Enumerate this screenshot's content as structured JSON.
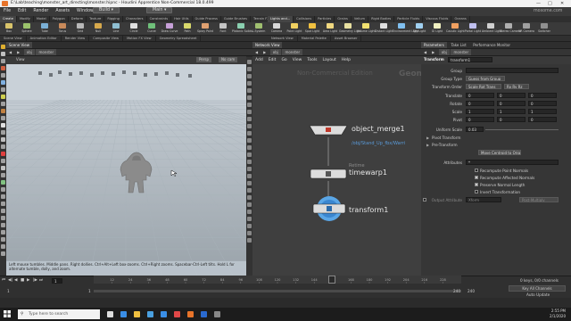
{
  "window": {
    "path": "E:\\Lab\\teaching\\monster_art_directing\\monster.hipnc",
    "title_suffix": "Houdini Apprentice Non-Commercial 18.0.499",
    "watermark_site": "mosome.com"
  },
  "menubar": {
    "items": [
      "File",
      "Edit",
      "Render",
      "Assets",
      "Windows",
      "Help"
    ],
    "build_dropdown": "Build",
    "main_dropdown": "Main"
  },
  "shelf_left": {
    "tabs": [
      "Create",
      "Modify",
      "Model",
      "Polygon",
      "Deform",
      "Texture",
      "Rigging",
      "Characters",
      "Constraints",
      "Hair Utils",
      "Guide Process",
      "Guide Brushes",
      "Terrain FX"
    ],
    "tools": [
      "Box",
      "Sphere",
      "Tube",
      "Torus",
      "Grid",
      "Null",
      "Line",
      "Circle",
      "Curve",
      "Draw Curve",
      "Path",
      "Spray Paint",
      "Font",
      "Platonic Solids",
      "L-System"
    ]
  },
  "shelf_right": {
    "tabs": [
      "Lights and...",
      "Collisions",
      "Particles",
      "Grains",
      "Vellum",
      "Rigid Bodies",
      "Particle Fluids",
      "Viscous Fluids",
      "Oceans"
    ],
    "tools": [
      "Camera",
      "Point Light",
      "Spot Light",
      "Area Light",
      "Geometry Light",
      "Volume Light",
      "Distant Light",
      "Environment Light",
      "Sky Light",
      "GI Light",
      "Caustic Light",
      "Portal Light",
      "Ambient Light",
      "Stereo Camera",
      "VR Camera",
      "Switcher"
    ]
  },
  "pane_tabs": [
    "Scene View",
    "Animation Editor",
    "Render View",
    "Composite View",
    "Motion FX View",
    "Geometry Spreadsheet",
    "Network View",
    "Material Palette",
    "Asset Browser",
    "Parameters",
    "Take List",
    "Performance Monitor"
  ],
  "viewport": {
    "path_obj": "obj",
    "path_node": "monster",
    "view_label": "View",
    "persp_label": "Persp",
    "cam_label": "No cam",
    "status_text": "Left mouse tumbles. Middle pans. Right dollies. Ctrl+Alt+Left box-zooms. Ctrl+Right zooms. Spacebar-Ctrl-Left tilts. Hold L for alternate tumble, dolly, and zoom."
  },
  "network": {
    "path_obj": "obj",
    "path_node": "monster",
    "menu": [
      "Add",
      "Edit",
      "Go",
      "View",
      "Tools",
      "Layout",
      "Help"
    ],
    "watermark": "Non-Commercial Edition",
    "context_label": "Geometry",
    "nodes": [
      {
        "name": "object_merge1",
        "sub": "/obj/Stand_Up_fbx/Warri"
      },
      {
        "name": "timewarp1",
        "sub": "Retime"
      },
      {
        "name": "transform1",
        "sub": ""
      }
    ]
  },
  "parameters": {
    "node_type": "Transform",
    "node_name": "transform1",
    "path_obj": "obj",
    "path_node": "monster",
    "rows": {
      "group": "Group",
      "group_type": "Group Type",
      "group_type_value": "Guess from Group",
      "transform_order": "Transform Order",
      "transform_order_value": "Scale Rot Trans",
      "rot_order_value": "Rx Ry Rz",
      "translate": "Translate",
      "translate_values": [
        "0",
        "0",
        "0"
      ],
      "rotate": "Rotate",
      "rotate_values": [
        "0",
        "0",
        "0"
      ],
      "scale": "Scale",
      "scale_values": [
        "1",
        "1",
        "1"
      ],
      "pivot": "Pivot",
      "pivot_values": [
        "0",
        "0",
        "0"
      ],
      "uniform_scale": "Uniform Scale",
      "uniform_scale_value": "0.03",
      "pivot_transform": "Pivot Transform",
      "pre_transform": "Pre-Transform",
      "move_centroid": "Move Centroid to Origin",
      "attributes": "Attributes",
      "attributes_value": "*",
      "recompute_point_normals": "Recompute Point Normals",
      "recompute_affected_normals": "Recompute Affected Normals",
      "preserve_normal_length": "Preserve Normal Length",
      "invert_transformation": "Invert Transformation",
      "output_attribute": "Output Attribute",
      "output_attribute_value": "Xform",
      "output_attribute_mode": "Post-Multiply"
    }
  },
  "timeline": {
    "current_frame": "1",
    "start_frame": "1",
    "end_frame": "240",
    "end_frame2": "240",
    "tick_labels": [
      "12",
      "24",
      "36",
      "48",
      "60",
      "72",
      "84",
      "96",
      "108",
      "120",
      "132",
      "144",
      "156",
      "168",
      "180",
      "192",
      "204",
      "216",
      "228"
    ],
    "keys_channels": "0 keys, 0/0 channels",
    "key_all_channels": "Key All Channels",
    "auto_update": "Auto Update"
  },
  "taskbar": {
    "search_placeholder": "Type here to search",
    "time": "2:55 PM",
    "date": "2/1/2020"
  }
}
